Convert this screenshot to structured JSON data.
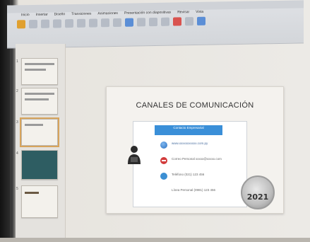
{
  "ribbon": {
    "window_title": "",
    "tabs": [
      "Inicio",
      "Insertar",
      "Diseño",
      "Transiciones",
      "Animaciones",
      "Presentación con diapositivas",
      "Revisar",
      "Vista"
    ]
  },
  "thumbnails": {
    "numbers": [
      "1",
      "2",
      "3",
      "4",
      "5"
    ]
  },
  "slide": {
    "title": "CANALES DE COMUNICACIÓN",
    "card_header": "Contacto Empresarial",
    "items": [
      {
        "text": "www.xxxxxxxxxxx.com.py"
      },
      {
        "text": "Correo Personal xxxxx@xxxxx.com"
      },
      {
        "text": "Teléfono (021) 123 456"
      },
      {
        "text": "Línea Personal (0981) 123 456"
      }
    ],
    "seal_year": "2021"
  },
  "colors": {
    "accent_blue": "#3a8fd8",
    "thumb_selected": "#d7a45c"
  }
}
